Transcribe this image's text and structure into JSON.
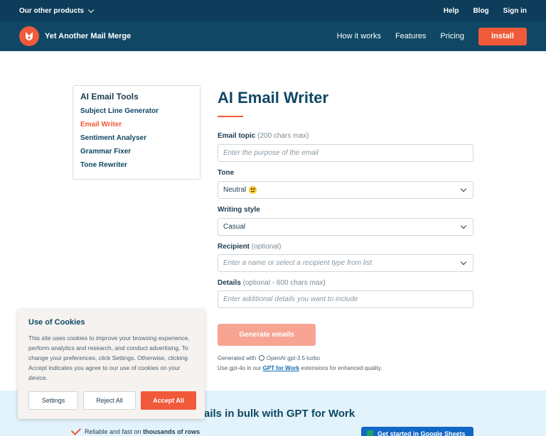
{
  "topbar": {
    "products_label": "Our other products",
    "links": [
      "Help",
      "Blog",
      "Sign in"
    ]
  },
  "nav": {
    "brand": "Yet Another Mail Merge",
    "links": [
      "How it works",
      "Features",
      "Pricing"
    ],
    "install_label": "Install",
    "accent_color": "#f05a3a"
  },
  "sidebar": {
    "title": "AI Email Tools",
    "items": [
      {
        "label": "Subject Line Generator",
        "active": false
      },
      {
        "label": "Email Writer",
        "active": true
      },
      {
        "label": "Sentiment Analyser",
        "active": false
      },
      {
        "label": "Grammar Fixer",
        "active": false
      },
      {
        "label": "Tone Rewriter",
        "active": false
      }
    ]
  },
  "main": {
    "title": "AI Email Writer",
    "topic": {
      "label": "Email topic",
      "hint": "(200 chars max)",
      "placeholder": "Enter the purpose of the email"
    },
    "tone": {
      "label": "Tone",
      "value": "Neutral"
    },
    "style": {
      "label": "Writing style",
      "value": "Casual"
    },
    "recipient": {
      "label": "Recipient",
      "hint": "(optional)",
      "placeholder": "Enter a name or select a recipient type from list"
    },
    "details": {
      "label": "Details",
      "hint": "(optional - 600 chars max)",
      "placeholder": "Enter additional details you want to include"
    },
    "generate_label": "Generate emails",
    "note1_prefix": "Generated with",
    "note1_model": "OpenAI gpt-3.5-turbo",
    "note2_prefix": "Use gpt-4o in our",
    "note2_link": "GPT for Work",
    "note2_suffix": "extensions for enhanced quality."
  },
  "band": {
    "title": "ails in bulk with GPT for Work",
    "reliable_prefix": "Reliable and fast on",
    "reliable_bold": "thousands of rows",
    "sheets_button": "Get started in Google Sheets"
  },
  "cookie": {
    "title": "Use of Cookies",
    "text": "This site uses cookies to improve your browsing experience, perform analytics and research, and conduct advertising. To change your preferences, click Settings. Otherwise, clicking Accept indicates you agree to our use of cookies on your device.",
    "settings": "Settings",
    "reject": "Reject All",
    "accept": "Accept All"
  }
}
